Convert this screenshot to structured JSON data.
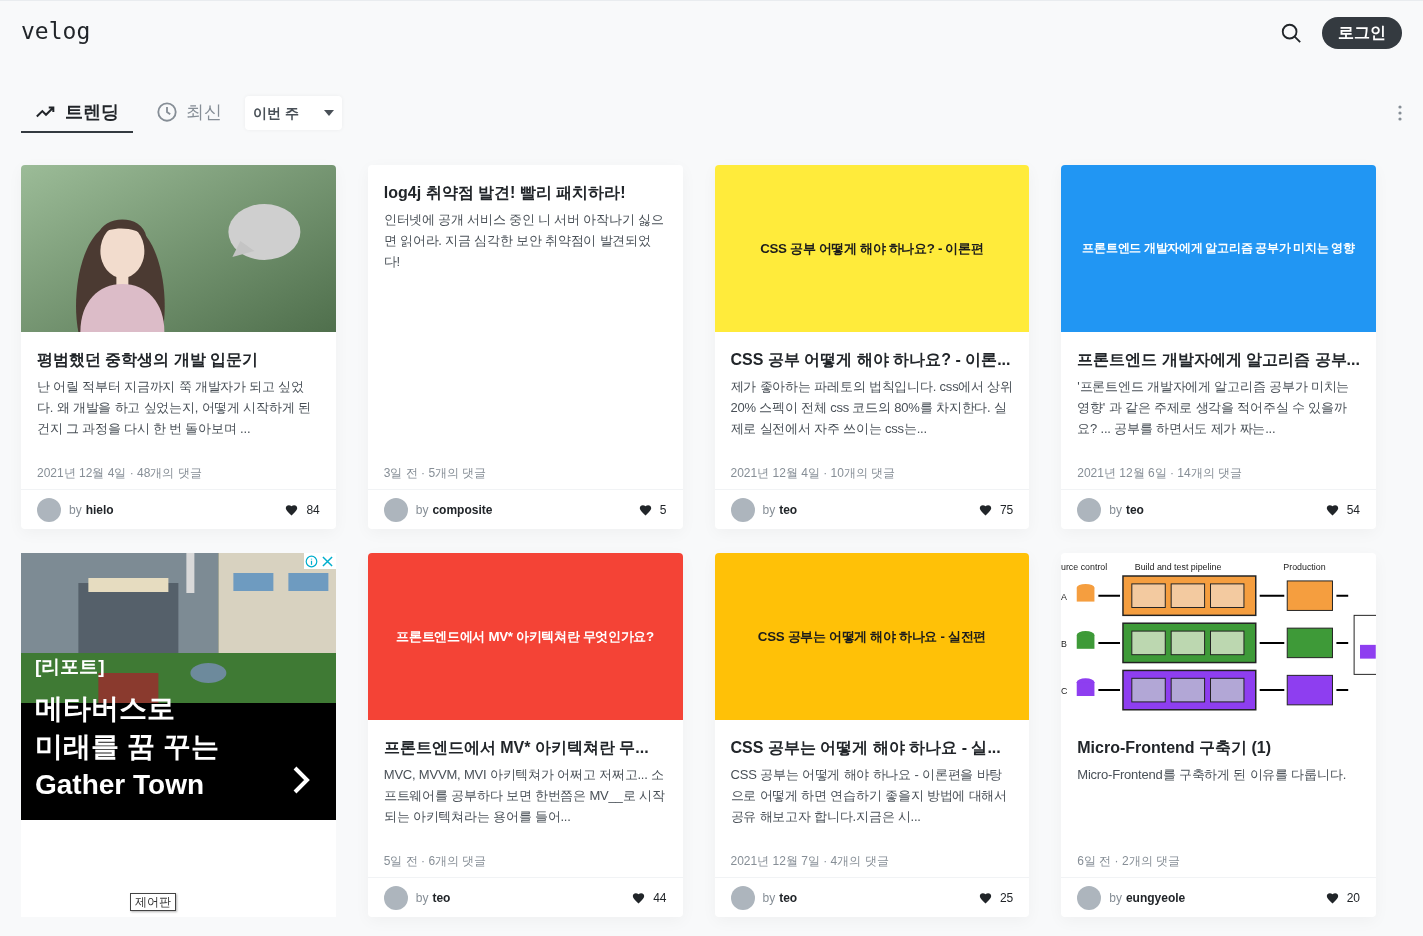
{
  "logo": "velog",
  "header": {
    "login_button": "로그인"
  },
  "tabs": [
    {
      "label": "트렌딩",
      "selected": true
    },
    {
      "label": "최신",
      "selected": false
    }
  ],
  "period_select": {
    "value": "이번 주"
  },
  "posts": [
    {
      "kind": "post",
      "title": "평범했던 중학생의 개발 입문기",
      "description": "난 어릴 적부터 지금까지 쭉 개발자가 되고 싶었다. 왜 개발을 하고 싶었는지, 어떻게 시작하게 된 건지 그 과정을 다시 한 번 돌아보며 ...",
      "meta": "2021년 12월 4일 · 48개의 댓글",
      "by_label": "by",
      "author": "hielo",
      "likes": "84"
    },
    {
      "kind": "post",
      "title": "log4j 취약점 발견! 빨리 패치하라!",
      "description": "인터넷에 공개 서비스 중인 니 서버 아작나기 싫으면 읽어라. 지금 심각한 보안 취약점이 발견되었다!",
      "meta": "3일 전 · 5개의 댓글",
      "by_label": "by",
      "author": "composite",
      "likes": "5"
    },
    {
      "kind": "post",
      "thumbnail": {
        "kind": "banner",
        "text": "CSS 공부 어떻게 해야 하나요? - 이론편",
        "color": "#ffeb3b"
      },
      "title": "CSS 공부 어떻게 해야 하나요? - 이론...",
      "description": "제가 좋아하는 파레토의 법칙입니다. css에서 상위 20% 스펙이 전체 css 코드의 80%를 차지한다. 실제로 실전에서 자주 쓰이는 css는...",
      "meta": "2021년 12월 4일 · 10개의 댓글",
      "by_label": "by",
      "author": "teo",
      "likes": "75"
    },
    {
      "kind": "post",
      "thumbnail": {
        "kind": "banner",
        "text": "프론트엔드 개발자에게 알고리즘 공부가 미치는 영향",
        "color": "#2196f3"
      },
      "title": "프론트엔드 개발자에게 알고리즘 공부...",
      "description": "'프론트엔드 개발자에게 알고리즘 공부가 미치는 영향' 과 같은 주제로 생각을 적어주실 수 있을까요? ... 공부를 하면서도 제가 짜는...",
      "meta": "2021년 12월 6일 · 14개의 댓글",
      "by_label": "by",
      "author": "teo",
      "likes": "54"
    },
    {
      "kind": "ad",
      "tag": "[리포트]",
      "headline": [
        "메타버스로",
        "미래를 꿈 꾸는",
        "Gather Town"
      ],
      "control_label": "제어판"
    },
    {
      "kind": "post",
      "thumbnail": {
        "kind": "banner",
        "text": "프론트엔드에서 MV* 아키텍쳐란 무엇인가요?",
        "color": "#f44336"
      },
      "title": "프론트엔드에서 MV* 아키텍쳐란 무...",
      "description": "MVC, MVVM, MVI 아키텍쳐가 어쩌고 저쩌고... 소프트웨어를 공부하다 보면 한번쯤은 MV__로 시작되는 아키텍쳐라는 용어를 들어...",
      "meta": "5일 전 · 6개의 댓글",
      "by_label": "by",
      "author": "teo",
      "likes": "44"
    },
    {
      "kind": "post",
      "thumbnail": {
        "kind": "banner",
        "text": "CSS 공부는 어떻게 해야 하나요 - 실전편",
        "color": "#ffc107"
      },
      "title": "CSS 공부는 어떻게 해야 하나요 - 실...",
      "description": "CSS 공부는 어떻게 해야 하나요 - 이론편을 바탕으로 어떻게 하면 연습하기 좋을지 방법에 대해서 공유 해보고자 합니다.지금은 시...",
      "meta": "2021년 12월 7일 · 4개의 댓글",
      "by_label": "by",
      "author": "teo",
      "likes": "25"
    },
    {
      "kind": "post",
      "thumbnail": {
        "kind": "diagram",
        "labels": [
          "urce control",
          "Build and test pipeline",
          "Production"
        ],
        "rows": [
          "A",
          "B",
          "C"
        ]
      },
      "title": "Micro-Frontend 구축기 (1)",
      "description": "Micro-Frontend를 구축하게 된 이유를 다룹니다.",
      "meta": "6일 전 · 2개의 댓글",
      "by_label": "by",
      "author": "eungyeole",
      "likes": "20"
    }
  ]
}
